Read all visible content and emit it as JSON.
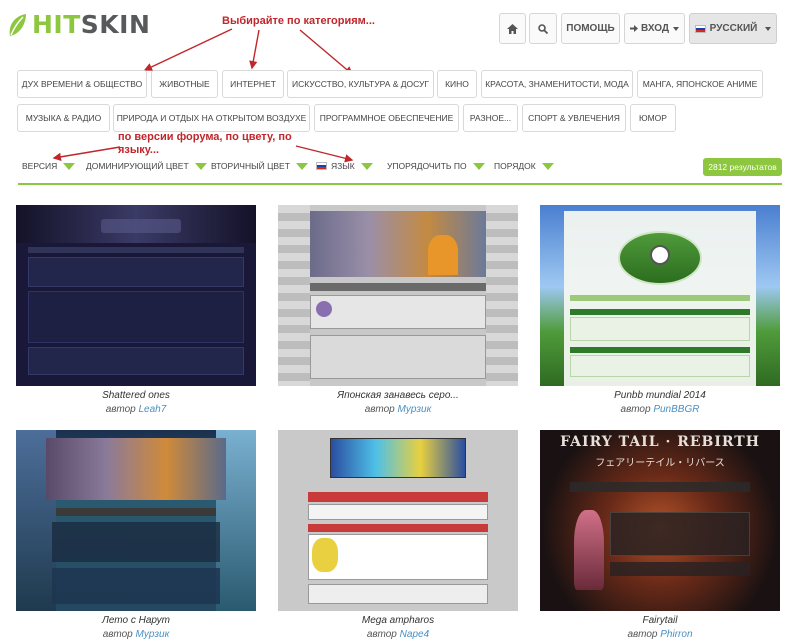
{
  "header": {
    "logo_hit": "HIT",
    "logo_skin": "SKIN",
    "help_label": "ПОМОЩЬ",
    "login_label": "ВХОД",
    "language_label": "РУССКИЙ"
  },
  "annotations": {
    "categories_note": "Выбирайте по категориям...",
    "filters_note": "по версии форума, по цвету, по языку..."
  },
  "categories": [
    "Дух времени & Общество",
    "Животные",
    "Интернет",
    "Искусство, культура & досуг",
    "Кино",
    "Красота, знаменитости, мода",
    "Манга, японское аниме",
    "Музыка & Радио",
    "Природа и отдых на открытом воздухе",
    "Программное обеспечение",
    "Разное...",
    "Спорт & Увлечения",
    "Юмор"
  ],
  "filters": {
    "version": "Версия",
    "dominant_color": "Доминирующий цвет",
    "secondary_color": "Вторичный цвет",
    "language": "Язык",
    "sort_by": "Упорядочить по",
    "order": "Порядок"
  },
  "results_label": "2812 результатов",
  "author_prefix": "автор",
  "skins": [
    {
      "title": "Shattered ones",
      "author": "Leah7"
    },
    {
      "title": "Японская занавесь серо...",
      "author": "Мурзик"
    },
    {
      "title": "Punbb mundial 2014",
      "author": "PunBBGR"
    },
    {
      "title": "Лето с Нарут",
      "author": "Мурзик"
    },
    {
      "title": "Mega ampharos",
      "author": "Nape4"
    },
    {
      "title": "Fairytail",
      "author": "Phirron"
    }
  ],
  "thumb_text": {
    "t6_title": "FAIRY TAIL · REBIRTH",
    "t6_sub": "フェアリーテイル・リバース"
  },
  "colors": {
    "brand_green": "#8dc63f",
    "annotation_red": "#c0262b",
    "link_blue": "#4a90c2"
  }
}
